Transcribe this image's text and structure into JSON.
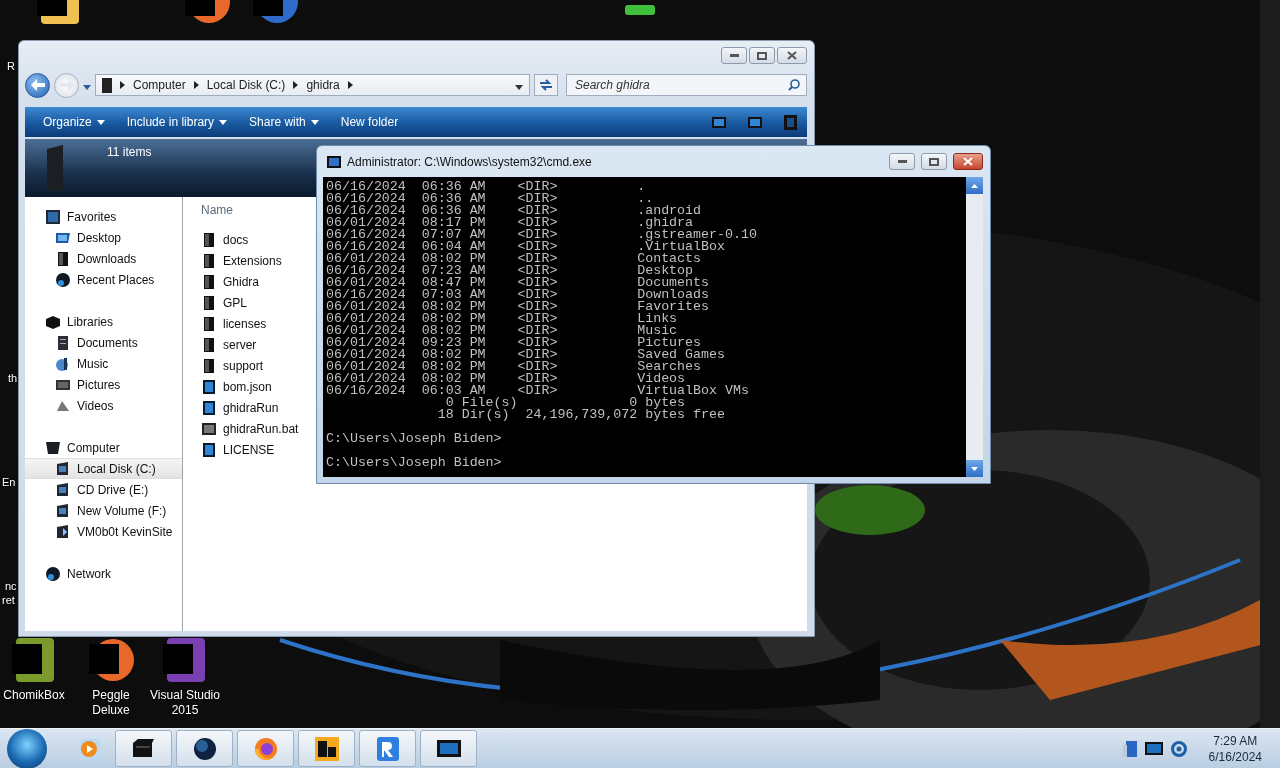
{
  "desktop": {
    "top_icons": [
      {
        "kind": "files"
      },
      {
        "kind": "orange"
      },
      {
        "kind": "blue"
      }
    ],
    "edge_labels": [
      {
        "text": "R"
      },
      {
        "text": "th"
      },
      {
        "text": "En"
      },
      {
        "text": "nc"
      },
      {
        "text": "ret"
      }
    ],
    "bottom_icons": [
      {
        "kind": "green",
        "label": "ChomikBox"
      },
      {
        "kind": "orange",
        "label": "Peggle Deluxe"
      },
      {
        "kind": "purple",
        "label": "Visual Studio 2015"
      }
    ]
  },
  "explorer": {
    "address": [
      "Computer",
      "Local Disk (C:)",
      "ghidra"
    ],
    "search": {
      "placeholder": "Search ghidra"
    },
    "toolbar": [
      {
        "label": "Organize",
        "dropdown": true
      },
      {
        "label": "Include in library",
        "dropdown": true
      },
      {
        "label": "Share with",
        "dropdown": true
      },
      {
        "label": "New folder",
        "dropdown": false
      }
    ],
    "details": "11 items",
    "nav": [
      {
        "label": "Favorites",
        "kind": "star",
        "selected": false,
        "children": [
          {
            "label": "Desktop",
            "kind": "desktop",
            "selected": false
          },
          {
            "label": "Downloads",
            "kind": "folder",
            "selected": false
          },
          {
            "label": "Recent Places",
            "kind": "globe",
            "selected": false
          }
        ]
      },
      {
        "label": "Libraries",
        "kind": "library",
        "selected": false,
        "children": [
          {
            "label": "Documents",
            "kind": "doc",
            "selected": false
          },
          {
            "label": "Music",
            "kind": "music",
            "selected": false
          },
          {
            "label": "Pictures",
            "kind": "picture",
            "selected": false
          },
          {
            "label": "Videos",
            "kind": "video",
            "selected": false
          }
        ]
      },
      {
        "label": "Computer",
        "kind": "computer",
        "selected": false,
        "children": [
          {
            "label": "Local Disk (C:)",
            "kind": "drive",
            "selected": true
          },
          {
            "label": "CD Drive (E:)",
            "kind": "drive",
            "selected": false
          },
          {
            "label": "New Volume (F:)",
            "kind": "drive",
            "selected": false
          },
          {
            "label": "VM0b0t KevinSite",
            "kind": "netdrive",
            "selected": false
          }
        ]
      },
      {
        "label": "Network",
        "kind": "globe",
        "selected": false
      }
    ],
    "column": "Name",
    "files": [
      {
        "name": "docs",
        "kind": "folder"
      },
      {
        "name": "Extensions",
        "kind": "folder"
      },
      {
        "name": "Ghidra",
        "kind": "folder"
      },
      {
        "name": "GPL",
        "kind": "folder"
      },
      {
        "name": "licenses",
        "kind": "folder"
      },
      {
        "name": "server",
        "kind": "folder"
      },
      {
        "name": "support",
        "kind": "folder"
      },
      {
        "name": "bom.json",
        "kind": "file"
      },
      {
        "name": "ghidraRun",
        "kind": "file"
      },
      {
        "name": "ghidraRun.bat",
        "kind": "batch"
      },
      {
        "name": "LICENSE",
        "kind": "file"
      }
    ]
  },
  "cmd": {
    "title": "Administrator: C:\\Windows\\system32\\cmd.exe",
    "lines": [
      "06/16/2024  06:36 AM    <DIR>          .",
      "06/16/2024  06:36 AM    <DIR>          ..",
      "06/16/2024  06:36 AM    <DIR>          .android",
      "06/01/2024  08:17 PM    <DIR>          .ghidra",
      "06/16/2024  07:07 AM    <DIR>          .gstreamer-0.10",
      "06/16/2024  06:04 AM    <DIR>          .VirtualBox",
      "06/01/2024  08:02 PM    <DIR>          Contacts",
      "06/16/2024  07:23 AM    <DIR>          Desktop",
      "06/01/2024  08:47 PM    <DIR>          Documents",
      "06/16/2024  07:03 AM    <DIR>          Downloads",
      "06/01/2024  08:02 PM    <DIR>          Favorites",
      "06/01/2024  08:02 PM    <DIR>          Links",
      "06/01/2024  08:02 PM    <DIR>          Music",
      "06/01/2024  09:23 PM    <DIR>          Pictures",
      "06/01/2024  08:02 PM    <DIR>          Saved Games",
      "06/01/2024  08:02 PM    <DIR>          Searches",
      "06/01/2024  08:02 PM    <DIR>          Videos",
      "06/16/2024  06:03 AM    <DIR>          VirtualBox VMs",
      "               0 File(s)              0 bytes",
      "              18 Dir(s)  24,196,739,072 bytes free"
    ],
    "prompts": [
      "C:\\Users\\Joseph Biden>",
      "C:\\Users\\Joseph Biden>"
    ]
  },
  "taskbar": {
    "apps": [
      {
        "kind": "media",
        "running": false
      },
      {
        "kind": "archive",
        "running": true
      },
      {
        "kind": "globe",
        "running": true
      },
      {
        "kind": "firefox",
        "running": true
      },
      {
        "kind": "de",
        "running": true
      },
      {
        "kind": "rvc",
        "running": true
      },
      {
        "kind": "monitor",
        "running": true
      }
    ],
    "tray": [
      {
        "kind": "flag"
      },
      {
        "kind": "monitor"
      },
      {
        "kind": "sync"
      }
    ],
    "clock": {
      "time": "7:29 AM",
      "date": "6/16/2024"
    }
  }
}
